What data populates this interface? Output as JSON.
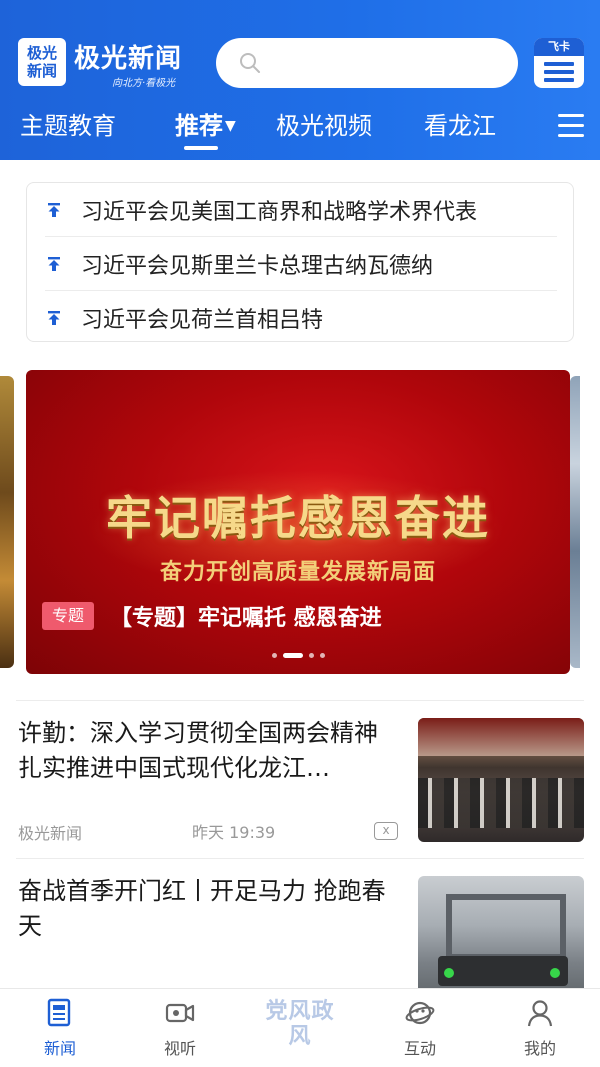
{
  "header": {
    "logo_mark": [
      "极光",
      "新闻"
    ],
    "app_name": "极光新闻",
    "slogan": "向北方·看极光",
    "search_placeholder": "",
    "feika_label": "飞卡"
  },
  "tabs": [
    {
      "label": "主题教育"
    },
    {
      "label": "推荐",
      "active": true
    },
    {
      "label": "极光视频"
    },
    {
      "label": "看龙江"
    }
  ],
  "top_news": [
    {
      "title": "习近平会见美国工商界和战略学术界代表"
    },
    {
      "title": "习近平会见斯里兰卡总理古纳瓦德纳"
    },
    {
      "title": "习近平会见荷兰首相吕特"
    }
  ],
  "banner": {
    "headline": "牢记嘱托感恩奋进",
    "subheadline": "奋力开创高质量发展新局面",
    "badge": "专题",
    "caption": "【专题】牢记嘱托 感恩奋进",
    "slide_count": 4,
    "active_slide": 2
  },
  "news": [
    {
      "title": "许勤：深入学习贯彻全国两会精神 扎实推进中国式现代化龙江…",
      "source": "极光新闻",
      "time": "昨天 19:39",
      "close_label": "x"
    },
    {
      "title": "奋战首季开门红丨开足马力 抢跑春天",
      "source": "",
      "time": ""
    }
  ],
  "bottom_nav": [
    {
      "label": "新闻",
      "icon": "news-icon",
      "active": true
    },
    {
      "label": "视听",
      "icon": "video-icon"
    },
    {
      "label": "党风政风",
      "icon": "party-style-badge"
    },
    {
      "label": "互动",
      "icon": "planet-icon"
    },
    {
      "label": "我的",
      "icon": "user-icon"
    }
  ],
  "colors": {
    "brand_blue": "#1e63d9",
    "banner_red": "#b0060b",
    "banner_gold": "#f6d98a",
    "badge_pink": "#ef5a6d"
  }
}
